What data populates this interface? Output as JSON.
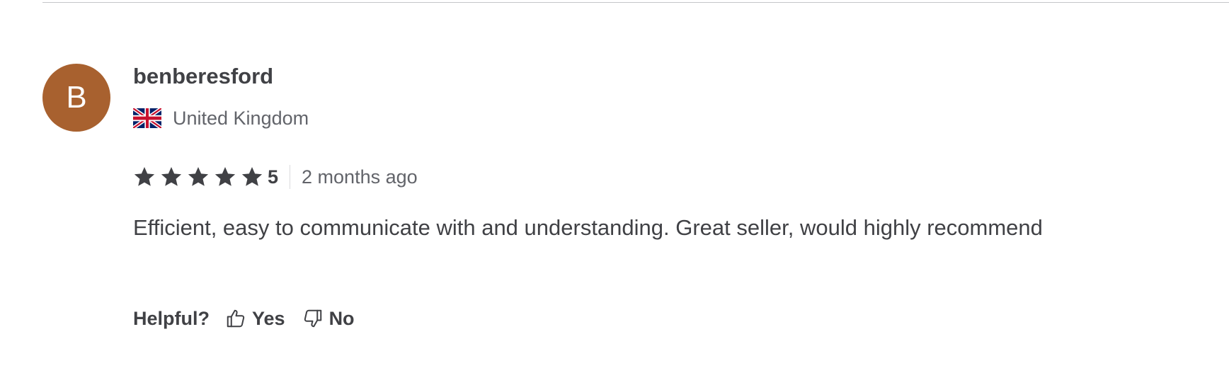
{
  "review": {
    "avatar_initial": "B",
    "avatar_color": "#a8612f",
    "username": "benberesford",
    "country": "United Kingdom",
    "country_flag_icon": "uk-flag-icon",
    "rating": 5,
    "rating_label": "5",
    "time_ago": "2 months ago",
    "text": "Efficient, easy to communicate with and understanding. Great seller, would highly recommend"
  },
  "helpful": {
    "label": "Helpful?",
    "yes_label": "Yes",
    "no_label": "No",
    "yes_icon": "thumbs-up-icon",
    "no_icon": "thumbs-down-icon"
  },
  "colors": {
    "text": "#404145",
    "muted": "#62646a",
    "star": "#404145"
  }
}
